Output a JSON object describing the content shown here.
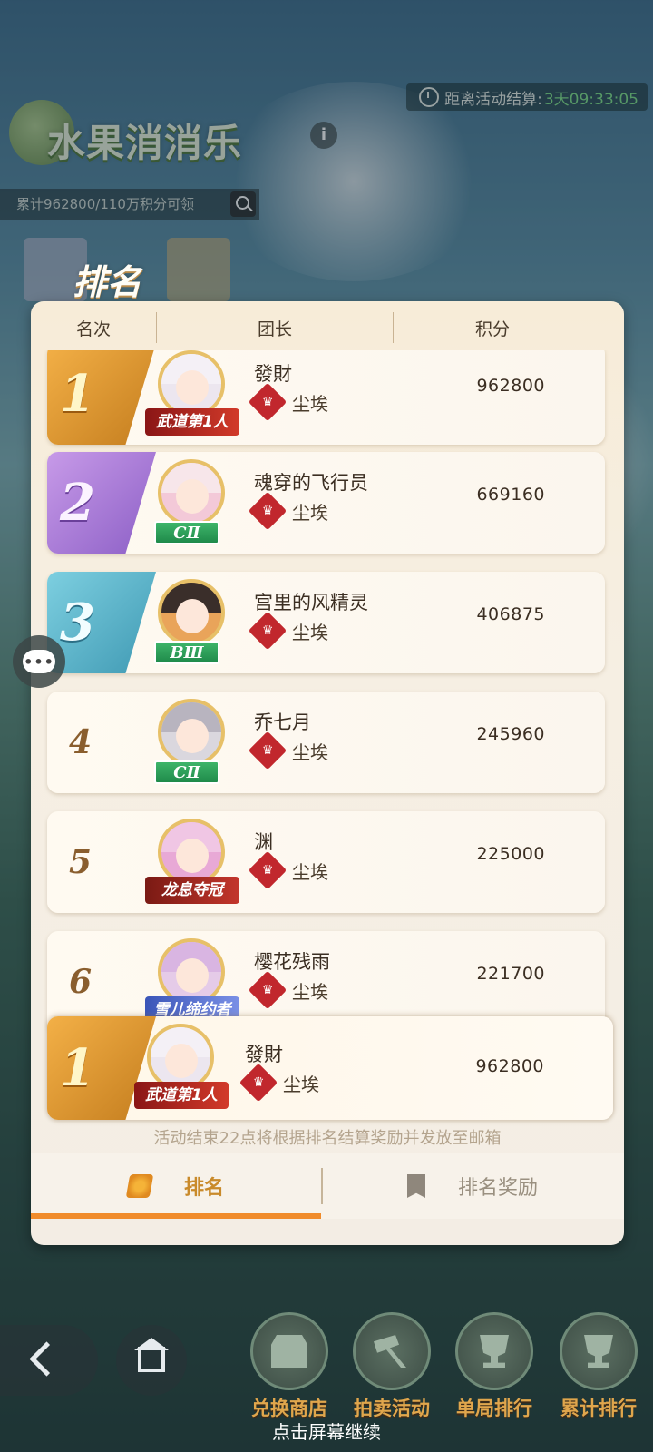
{
  "header": {
    "countdown_label": "距离活动结算:",
    "countdown_value": "3天09:33:05",
    "game_title": "水果消消乐",
    "info": "i",
    "progress_text": "累计962800/110万积分可领"
  },
  "panel": {
    "title": "排名",
    "columns": {
      "rank": "名次",
      "leader": "团长",
      "score": "积分"
    },
    "rows": [
      {
        "rank": "1",
        "name": "發財",
        "guild": "尘埃",
        "score": "962800",
        "badge": "武道第1人",
        "badge_type": "title"
      },
      {
        "rank": "2",
        "name": "魂穿的飞行员",
        "guild": "尘埃",
        "score": "669160",
        "badge": "CⅡ",
        "badge_type": "green"
      },
      {
        "rank": "3",
        "name": "宫里的风精灵",
        "guild": "尘埃",
        "score": "406875",
        "badge": "BⅢ",
        "badge_type": "green"
      },
      {
        "rank": "4",
        "name": "乔七月",
        "guild": "尘埃",
        "score": "245960",
        "badge": "CⅡ",
        "badge_type": "green"
      },
      {
        "rank": "5",
        "name": "渊",
        "guild": "尘埃",
        "score": "225000",
        "badge": "龙息夺冠",
        "badge_type": "title"
      },
      {
        "rank": "6",
        "name": "樱花残雨",
        "guild": "尘埃",
        "score": "221700",
        "badge": "雪儿缔约者",
        "badge_type": "title"
      }
    ],
    "my_row": {
      "rank": "1",
      "name": "發財",
      "guild": "尘埃",
      "score": "962800",
      "badge": "武道第1人"
    },
    "notice": "活动结束22点将根据排名结算奖励并发放至邮箱",
    "tabs": {
      "rank": "排名",
      "reward": "排名奖励"
    }
  },
  "bottom": {
    "items": [
      "兑换商店",
      "拍卖活动",
      "单局排行",
      "累计排行"
    ],
    "continue": "点击屏幕继续"
  }
}
